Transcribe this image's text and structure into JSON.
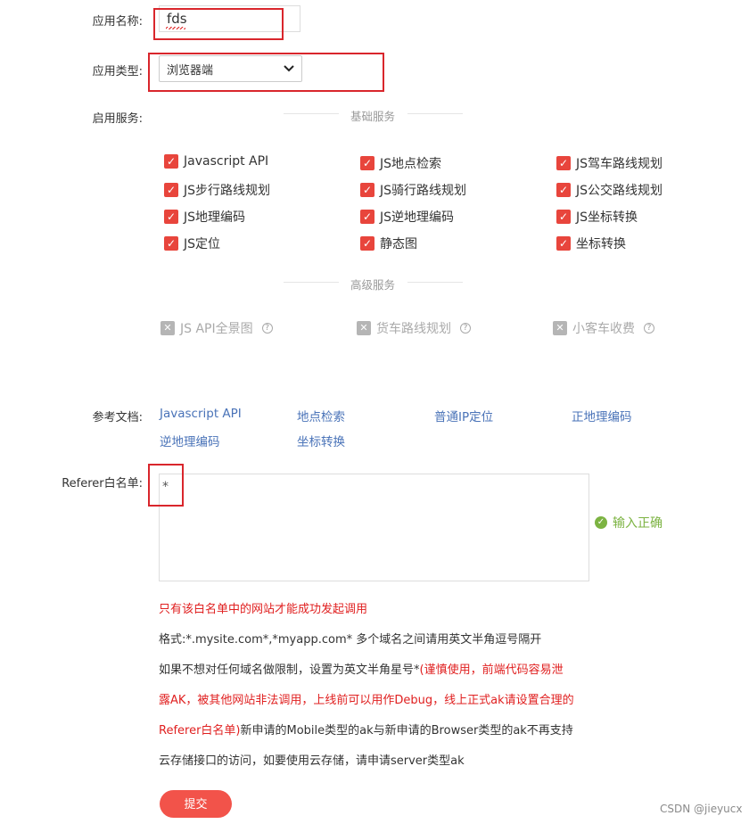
{
  "form": {
    "app_name_label": "应用名称:",
    "app_name_value": "fds",
    "app_type_label": "应用类型:",
    "app_type_value": "浏览器端",
    "services_label": "启用服务:",
    "basic_services_title": "基础服务",
    "basic_services": [
      "Javascript API",
      "JS地点检索",
      "JS驾车路线规划",
      "JS步行路线规划",
      "JS骑行路线规划",
      "JS公交路线规划",
      "JS地理编码",
      "JS逆地理编码",
      "JS坐标转换",
      "JS定位",
      "静态图",
      "坐标转换"
    ],
    "advanced_services_title": "高级服务",
    "advanced_services": [
      "JS API全景图",
      "货车路线规划",
      "小客车收费"
    ],
    "docs_label": "参考文档:",
    "docs": [
      "Javascript API",
      "地点检索",
      "普通IP定位",
      "正地理编码",
      "逆地理编码",
      "坐标转换"
    ],
    "referer_label": "Referer白名单:",
    "referer_value": "*",
    "referer_status": "输入正确",
    "notes": {
      "line1": "只有该白名单中的网站才能成功发起调用",
      "line2": "格式:*.mysite.com*,*myapp.com* 多个域名之间请用英文半角逗号隔开",
      "line3_black": "如果不想对任何域名做限制，设置为英文半角星号*",
      "line3_red": "(谨慎使用，前端代码容易泄",
      "line4_red": "露AK，被其他网站非法调用，上线前可以用作Debug，线上正式ak请设置合理的",
      "line5_red": "Referer白名单)",
      "line5_black": "新申请的Mobile类型的ak与新申请的Browser类型的ak不再支持",
      "line6": "云存储接口的访问，如要使用云存储，请申请server类型ak"
    },
    "submit_label": "提交"
  },
  "watermark": "CSDN @jieyucx",
  "icons": {
    "checkbox_checked": "check-icon",
    "checkbox_disabled": "x-icon",
    "help": "question-icon",
    "select_arrow": "chevron-down-icon",
    "status_ok": "check-circle-icon"
  },
  "colors": {
    "accent": "#e8453c",
    "link": "#4a73b8",
    "success": "#7cb342",
    "warning_text": "#e02020",
    "highlight_box": "#d9262c",
    "submit": "#f2534a"
  }
}
